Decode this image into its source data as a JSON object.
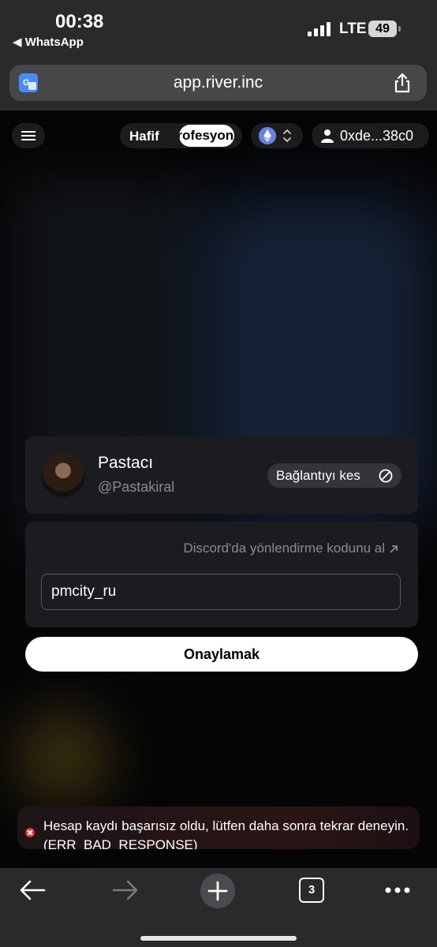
{
  "status_bar": {
    "time": "00:38",
    "back_app": "◀ WhatsApp",
    "network": "LTE",
    "battery": "49"
  },
  "browser": {
    "url": "app.river.inc",
    "open_tabs": "3"
  },
  "nav": {
    "mode_light": "Hafif",
    "mode_pro": "Profesyonel",
    "chain_icon": "ethereum-icon",
    "wallet": "0xde...38c0"
  },
  "profile": {
    "name": "Pastacı",
    "handle": "@Pastakiral",
    "disconnect_label": "Bağlantıyı kes"
  },
  "code": {
    "discord_link": "Discord'da yönlendirme kodunu al",
    "input_value": "pmcity_ru"
  },
  "confirm_label": "Onaylamak",
  "error_toast": "Hesap kaydı başarısız oldu, lütfen daha sonra tekrar deneyin. (ERR_BAD_RESPONSE)",
  "colors": {
    "accent": "#ffffff",
    "error": "#e0323a",
    "card": "#1b1c1f",
    "eth": "#6b7fe3"
  }
}
